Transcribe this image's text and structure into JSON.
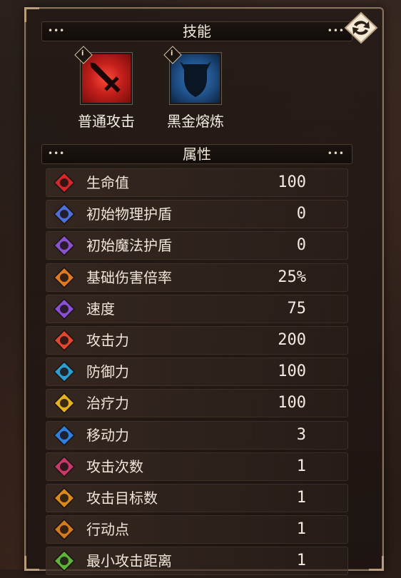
{
  "skills_section": {
    "title": "技能"
  },
  "skills": [
    {
      "name": "普通攻击",
      "color": "#c5201c"
    },
    {
      "name": "黑金熔炼",
      "color": "#1f4f86"
    }
  ],
  "attributes_section": {
    "title": "属性"
  },
  "attributes": [
    {
      "label": "生命值",
      "value": "100",
      "icon": "heart-icon",
      "color": "#d2282a"
    },
    {
      "label": "初始物理护盾",
      "value": "0",
      "icon": "physical-shield-icon",
      "color": "#4d6fd8"
    },
    {
      "label": "初始魔法护盾",
      "value": "0",
      "icon": "magic-shield-icon",
      "color": "#8a52d0"
    },
    {
      "label": "基础伤害倍率",
      "value": "25%",
      "icon": "damage-multiplier-icon",
      "color": "#e07a1e"
    },
    {
      "label": "速度",
      "value": "75",
      "icon": "speed-icon",
      "color": "#8a4fd6"
    },
    {
      "label": "攻击力",
      "value": "200",
      "icon": "attack-icon",
      "color": "#e2462e"
    },
    {
      "label": "防御力",
      "value": "100",
      "icon": "defense-icon",
      "color": "#2a9fd0"
    },
    {
      "label": "治疗力",
      "value": "100",
      "icon": "heal-icon",
      "color": "#e6b21c"
    },
    {
      "label": "移动力",
      "value": "3",
      "icon": "movement-icon",
      "color": "#2f7fe0"
    },
    {
      "label": "攻击次数",
      "value": "1",
      "icon": "attack-count-icon",
      "color": "#c8386a"
    },
    {
      "label": "攻击目标数",
      "value": "1",
      "icon": "target-count-icon",
      "color": "#d98a1a"
    },
    {
      "label": "行动点",
      "value": "1",
      "icon": "action-point-icon",
      "color": "#d47a1c"
    },
    {
      "label": "最小攻击距离",
      "value": "1",
      "icon": "min-range-icon",
      "color": "#5fb23a"
    }
  ]
}
